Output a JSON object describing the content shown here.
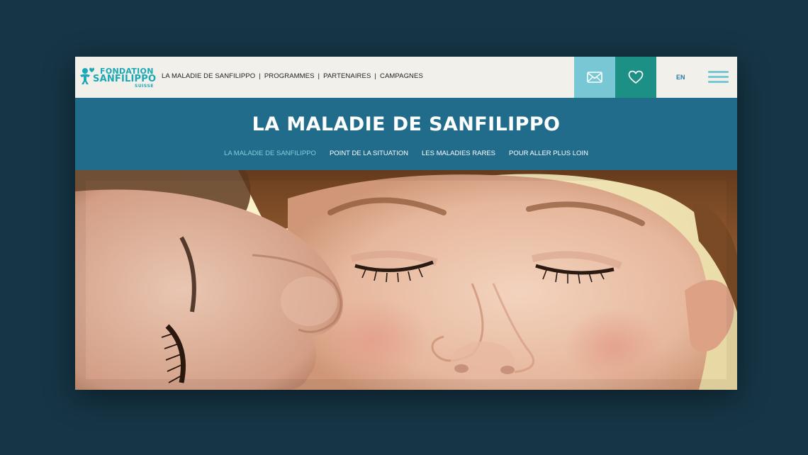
{
  "logo": {
    "line1": "FONDATION",
    "line2": "SANFILIPPO",
    "line3": "SUISSE"
  },
  "topnav": {
    "items": [
      {
        "label": "LA MALADIE DE SANFILIPPO"
      },
      {
        "label": "PROGRAMMES"
      },
      {
        "label": "PARTENAIRES"
      },
      {
        "label": "CAMPAGNES"
      }
    ],
    "separator": "|"
  },
  "actions": {
    "mail_icon": "envelope-icon",
    "donate_icon": "heart-icon",
    "language": "EN",
    "menu_icon": "hamburger-menu-icon"
  },
  "banner": {
    "title": "LA MALADIE DE SANFILIPPO",
    "subnav": [
      {
        "label": "LA MALADIE DE SANFILIPPO",
        "active": true
      },
      {
        "label": "POINT DE LA SITUATION",
        "active": false
      },
      {
        "label": "LES MALADIES RARES",
        "active": false
      },
      {
        "label": "POUR ALLER PLUS LOIN",
        "active": false
      }
    ]
  },
  "colors": {
    "background": "#163546",
    "topbar": "#f1f0ea",
    "brand_teal": "#1aa8b5",
    "mail_button": "#77c7d5",
    "donate_button": "#1d9085",
    "banner": "#216c8b",
    "subnav_active": "#7fd0e0",
    "language": "#2a7aa5"
  }
}
